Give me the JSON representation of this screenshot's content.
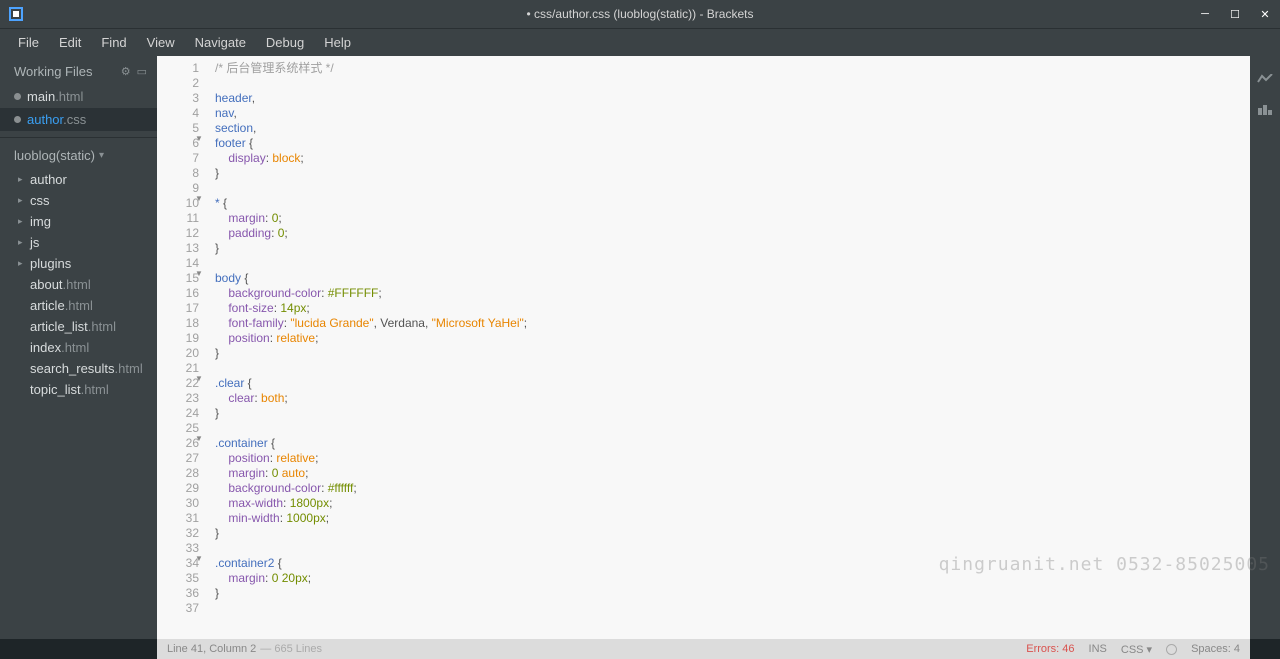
{
  "titlebar": {
    "title": "• css/author.css (luoblog(static)) - Brackets"
  },
  "menu": {
    "file": "File",
    "edit": "Edit",
    "find": "Find",
    "view": "View",
    "navigate": "Navigate",
    "debug": "Debug",
    "help": "Help"
  },
  "sidebar": {
    "working_files_label": "Working Files",
    "working_files": [
      {
        "name": "main",
        "ext": ".html",
        "active": false
      },
      {
        "name": "author",
        "ext": ".css",
        "active": true
      }
    ],
    "project_name": "luoblog(static)",
    "folders": [
      "author",
      "css",
      "img",
      "js",
      "plugins"
    ],
    "files": [
      {
        "name": "about",
        "ext": ".html"
      },
      {
        "name": "article",
        "ext": ".html"
      },
      {
        "name": "article_list",
        "ext": ".html"
      },
      {
        "name": "index",
        "ext": ".html"
      },
      {
        "name": "search_results",
        "ext": ".html"
      },
      {
        "name": "topic_list",
        "ext": ".html"
      }
    ]
  },
  "code": {
    "lines": [
      {
        "n": 1,
        "tokens": [
          [
            "/* 后台管理系统样式 */",
            "comment"
          ]
        ]
      },
      {
        "n": 2,
        "tokens": []
      },
      {
        "n": 3,
        "tokens": [
          [
            "header",
            "tag"
          ],
          [
            ",",
            "punc"
          ]
        ]
      },
      {
        "n": 4,
        "tokens": [
          [
            "nav",
            "tag"
          ],
          [
            ",",
            "punc"
          ]
        ]
      },
      {
        "n": 5,
        "tokens": [
          [
            "section",
            "tag"
          ],
          [
            ",",
            "punc"
          ]
        ]
      },
      {
        "n": 6,
        "fold": true,
        "tokens": [
          [
            "footer",
            "tag"
          ],
          [
            " {",
            "punc"
          ]
        ]
      },
      {
        "n": 7,
        "tokens": [
          [
            "    ",
            "punc"
          ],
          [
            "display",
            "prop"
          ],
          [
            ": ",
            "punc"
          ],
          [
            "block",
            "val"
          ],
          [
            ";",
            "punc"
          ]
        ]
      },
      {
        "n": 8,
        "tokens": [
          [
            "}",
            "punc"
          ]
        ]
      },
      {
        "n": 9,
        "tokens": []
      },
      {
        "n": 10,
        "fold": true,
        "tokens": [
          [
            "*",
            "tag"
          ],
          [
            " {",
            "punc"
          ]
        ]
      },
      {
        "n": 11,
        "tokens": [
          [
            "    ",
            "punc"
          ],
          [
            "margin",
            "prop"
          ],
          [
            ": ",
            "punc"
          ],
          [
            "0",
            "num"
          ],
          [
            ";",
            "punc"
          ]
        ]
      },
      {
        "n": 12,
        "tokens": [
          [
            "    ",
            "punc"
          ],
          [
            "padding",
            "prop"
          ],
          [
            ": ",
            "punc"
          ],
          [
            "0",
            "num"
          ],
          [
            ";",
            "punc"
          ]
        ]
      },
      {
        "n": 13,
        "tokens": [
          [
            "}",
            "punc"
          ]
        ]
      },
      {
        "n": 14,
        "tokens": []
      },
      {
        "n": 15,
        "fold": true,
        "tokens": [
          [
            "body",
            "tag"
          ],
          [
            " {",
            "punc"
          ]
        ]
      },
      {
        "n": 16,
        "tokens": [
          [
            "    ",
            "punc"
          ],
          [
            "background-color",
            "prop"
          ],
          [
            ": ",
            "punc"
          ],
          [
            "#FFFFFF",
            "num"
          ],
          [
            ";",
            "punc"
          ]
        ]
      },
      {
        "n": 17,
        "tokens": [
          [
            "    ",
            "punc"
          ],
          [
            "font-size",
            "prop"
          ],
          [
            ": ",
            "punc"
          ],
          [
            "14px",
            "num"
          ],
          [
            ";",
            "punc"
          ]
        ]
      },
      {
        "n": 18,
        "tokens": [
          [
            "    ",
            "punc"
          ],
          [
            "font-family",
            "prop"
          ],
          [
            ": ",
            "punc"
          ],
          [
            "\"lucida Grande\"",
            "str"
          ],
          [
            ", Verdana, ",
            "punc"
          ],
          [
            "\"Microsoft YaHei\"",
            "str"
          ],
          [
            ";",
            "punc"
          ]
        ]
      },
      {
        "n": 19,
        "tokens": [
          [
            "    ",
            "punc"
          ],
          [
            "position",
            "prop"
          ],
          [
            ": ",
            "punc"
          ],
          [
            "relative",
            "val"
          ],
          [
            ";",
            "punc"
          ]
        ]
      },
      {
        "n": 20,
        "tokens": [
          [
            "}",
            "punc"
          ]
        ]
      },
      {
        "n": 21,
        "tokens": []
      },
      {
        "n": 22,
        "fold": true,
        "tokens": [
          [
            ".clear",
            "tag"
          ],
          [
            " {",
            "punc"
          ]
        ]
      },
      {
        "n": 23,
        "tokens": [
          [
            "    ",
            "punc"
          ],
          [
            "clear",
            "prop"
          ],
          [
            ": ",
            "punc"
          ],
          [
            "both",
            "val"
          ],
          [
            ";",
            "punc"
          ]
        ]
      },
      {
        "n": 24,
        "tokens": [
          [
            "}",
            "punc"
          ]
        ]
      },
      {
        "n": 25,
        "tokens": []
      },
      {
        "n": 26,
        "fold": true,
        "tokens": [
          [
            ".container",
            "tag"
          ],
          [
            " {",
            "punc"
          ]
        ]
      },
      {
        "n": 27,
        "tokens": [
          [
            "    ",
            "punc"
          ],
          [
            "position",
            "prop"
          ],
          [
            ": ",
            "punc"
          ],
          [
            "relative",
            "val"
          ],
          [
            ";",
            "punc"
          ]
        ]
      },
      {
        "n": 28,
        "tokens": [
          [
            "    ",
            "punc"
          ],
          [
            "margin",
            "prop"
          ],
          [
            ": ",
            "punc"
          ],
          [
            "0",
            "num"
          ],
          [
            " ",
            "punc"
          ],
          [
            "auto",
            "val"
          ],
          [
            ";",
            "punc"
          ]
        ]
      },
      {
        "n": 29,
        "tokens": [
          [
            "    ",
            "punc"
          ],
          [
            "background-color",
            "prop"
          ],
          [
            ": ",
            "punc"
          ],
          [
            "#ffffff",
            "num"
          ],
          [
            ";",
            "punc"
          ]
        ]
      },
      {
        "n": 30,
        "tokens": [
          [
            "    ",
            "punc"
          ],
          [
            "max-width",
            "prop"
          ],
          [
            ": ",
            "punc"
          ],
          [
            "1800px",
            "num"
          ],
          [
            ";",
            "punc"
          ]
        ]
      },
      {
        "n": 31,
        "tokens": [
          [
            "    ",
            "punc"
          ],
          [
            "min-width",
            "prop"
          ],
          [
            ": ",
            "punc"
          ],
          [
            "1000px",
            "num"
          ],
          [
            ";",
            "punc"
          ]
        ]
      },
      {
        "n": 32,
        "tokens": [
          [
            "}",
            "punc"
          ]
        ]
      },
      {
        "n": 33,
        "tokens": []
      },
      {
        "n": 34,
        "fold": true,
        "tokens": [
          [
            ".container2",
            "tag"
          ],
          [
            " {",
            "punc"
          ]
        ]
      },
      {
        "n": 35,
        "tokens": [
          [
            "    ",
            "punc"
          ],
          [
            "margin",
            "prop"
          ],
          [
            ": ",
            "punc"
          ],
          [
            "0",
            "num"
          ],
          [
            " ",
            "punc"
          ],
          [
            "20px",
            "num"
          ],
          [
            ";",
            "punc"
          ]
        ]
      },
      {
        "n": 36,
        "tokens": [
          [
            "}",
            "punc"
          ]
        ]
      },
      {
        "n": 37,
        "tokens": []
      }
    ]
  },
  "status": {
    "cursor": "Line 41, Column 2",
    "lines": "— 665 Lines",
    "errors": "Errors: 46",
    "ins": "INS",
    "lang": "CSS",
    "spaces": "Spaces: 4"
  },
  "watermark": "qingruanit.net 0532-85025005"
}
